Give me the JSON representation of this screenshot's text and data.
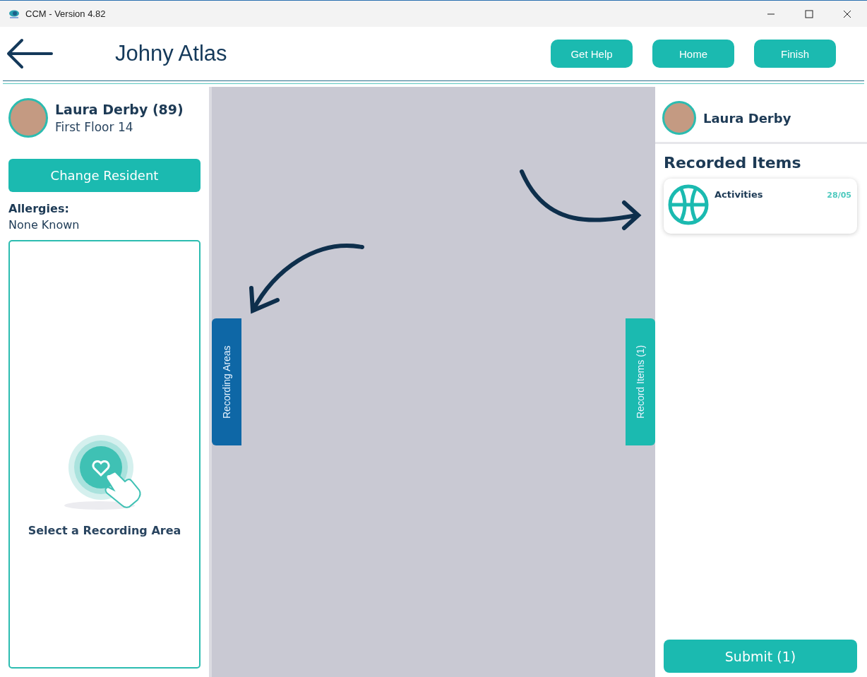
{
  "window": {
    "title": "CCM - Version 4.82"
  },
  "header": {
    "title": "Johny Atlas",
    "buttons": [
      "Get Help",
      "Home",
      "Finish"
    ]
  },
  "left_panel": {
    "resident_name": "Laura Derby (89)",
    "location": "First Floor 14",
    "change_button": "Change Resident",
    "allergies_label": "Allergies:",
    "allergies_value": "None Known",
    "empty_state": "Select a Recording Area"
  },
  "side_tabs": {
    "left": "Recording Areas",
    "right": "Record Items (1)"
  },
  "right_panel": {
    "resident_name": "Laura Derby",
    "heading": "Recorded Items",
    "items": [
      {
        "name": "Activities",
        "date": "28/05"
      }
    ],
    "submit": "Submit (1)"
  }
}
